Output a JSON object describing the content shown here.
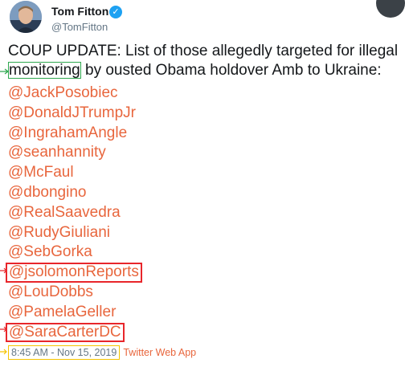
{
  "user": {
    "name": "Tom Fitton",
    "handle": "@TomFitton"
  },
  "tweet": {
    "line1": "COUP UPDATE: List of those allegedly targeted for illegal",
    "highlight_word": "monitoring",
    "line2_rest": " by ousted Obama holdover Amb to Ukraine:",
    "mentions": [
      "@JackPosobiec",
      "@DonaldJTrumpJr",
      "@IngrahamAngle",
      "@seanhannity",
      "@McFaul",
      "@dbongino",
      "@RealSaavedra",
      "@RudyGiuliani",
      "@SebGorka",
      "@jsolomonReports",
      "@LouDobbs",
      "@PamelaGeller",
      "@SaraCarterDC"
    ],
    "timestamp": "8:45 AM - Nov 15, 2019",
    "client": "Twitter Web App"
  },
  "colors": {
    "mention": "#e8663d",
    "verified": "#1da1f2",
    "highlight_green": "#2fa84f",
    "highlight_red": "#e8262b",
    "highlight_yellow": "#f5c400"
  }
}
